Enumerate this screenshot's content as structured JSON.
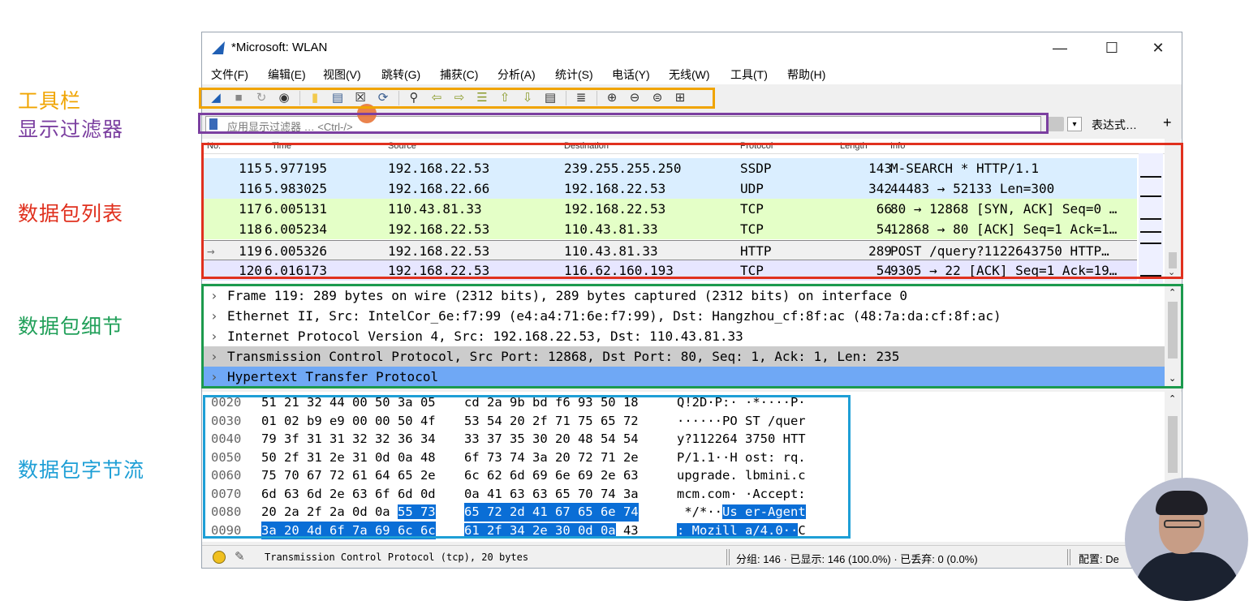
{
  "annotations": {
    "toolbar": "工具栏",
    "display_filter": "显示过滤器",
    "packet_list": "数据包列表",
    "packet_details": "数据包细节",
    "packet_bytes": "数据包字节流",
    "colors": {
      "toolbar": "#f0a400",
      "display_filter": "#7b3fa0",
      "packet_list": "#e0301e",
      "packet_details": "#1c9a4d",
      "packet_bytes": "#1e9fd6"
    }
  },
  "window": {
    "title": "*Microsoft: WLAN",
    "minimize": "—",
    "maximize": "☐",
    "close": "✕"
  },
  "menu": [
    "文件(F)",
    "编辑(E)",
    "视图(V)",
    "跳转(G)",
    "捕获(C)",
    "分析(A)",
    "统计(S)",
    "电话(Y)",
    "无线(W)",
    "工具(T)",
    "帮助(H)"
  ],
  "toolbar_icons": [
    "shark-fin-start",
    "stop",
    "restart",
    "options",
    "open",
    "save",
    "close-file",
    "reload",
    "find",
    "back",
    "forward",
    "go-to",
    "first",
    "last",
    "autoscroll",
    "colorize",
    "zoom-in",
    "zoom-out",
    "zoom-reset",
    "resize-columns"
  ],
  "filter": {
    "placeholder": "应用显示过滤器 … <Ctrl-/>",
    "dropdown": "▾",
    "expression": "表达式…",
    "add": "+"
  },
  "packet_list": {
    "headers": {
      "no": "No.",
      "time": "Time",
      "source": "Source",
      "destination": "Destination",
      "protocol": "Protocol",
      "length": "Length",
      "info": "Info"
    },
    "rows": [
      {
        "no": "115",
        "time": "5.977195",
        "src": "192.168.22.53",
        "dst": "239.255.255.250",
        "proto": "SSDP",
        "len": "143",
        "info": "M-SEARCH * HTTP/1.1",
        "bg": "#daeeff"
      },
      {
        "no": "116",
        "time": "5.983025",
        "src": "192.168.22.66",
        "dst": "192.168.22.53",
        "proto": "UDP",
        "len": "342",
        "info": "44483 → 52133 Len=300",
        "bg": "#daeeff"
      },
      {
        "no": "117",
        "time": "6.005131",
        "src": "110.43.81.33",
        "dst": "192.168.22.53",
        "proto": "TCP",
        "len": "66",
        "info": "80 → 12868 [SYN, ACK] Seq=0 …",
        "bg": "#e4ffc7"
      },
      {
        "no": "118",
        "time": "6.005234",
        "src": "192.168.22.53",
        "dst": "110.43.81.33",
        "proto": "TCP",
        "len": "54",
        "info": "12868 → 80 [ACK] Seq=1 Ack=1…",
        "bg": "#e4ffc7"
      },
      {
        "no": "119",
        "time": "6.005326",
        "src": "192.168.22.53",
        "dst": "110.43.81.33",
        "proto": "HTTP",
        "len": "289",
        "info": "POST /query?1122643750 HTTP…",
        "bg": "#f0f0f0"
      },
      {
        "no": "120",
        "time": "6.016173",
        "src": "192.168.22.53",
        "dst": "116.62.160.193",
        "proto": "TCP",
        "len": "54",
        "info": "9305 → 22 [ACK] Seq=1 Ack=19…",
        "bg": "#e7e6ff"
      }
    ]
  },
  "details": [
    {
      "text": "Frame 119: 289 bytes on wire (2312 bits), 289 bytes captured (2312 bits) on interface 0",
      "bg": "#ffffff",
      "color": "#000000"
    },
    {
      "text": "Ethernet II, Src: IntelCor_6e:f7:99 (e4:a4:71:6e:f7:99), Dst: Hangzhou_cf:8f:ac (48:7a:da:cf:8f:ac)",
      "bg": "#ffffff",
      "color": "#000000"
    },
    {
      "text": "Internet Protocol Version 4, Src: 192.168.22.53, Dst: 110.43.81.33",
      "bg": "#ffffff",
      "color": "#000000"
    },
    {
      "text": "Transmission Control Protocol, Src Port: 12868, Dst Port: 80, Seq: 1, Ack: 1, Len: 235",
      "bg": "#cccccc",
      "color": "#000000"
    },
    {
      "text": "Hypertext Transfer Protocol",
      "bg": "#6fa8f5",
      "color": "#000000"
    }
  ],
  "bytes": [
    {
      "off": "0020",
      "h1": "51 21 32 44 00 50 3a 05",
      "h2": "cd 2a 9b bd f6 93 50 18",
      "a": "Q!2D·P:· ·*····P·"
    },
    {
      "off": "0030",
      "h1": "01 02 b9 e9 00 00 50 4f",
      "h2": "53 54 20 2f 71 75 65 72",
      "a": "······PO ST /quer"
    },
    {
      "off": "0040",
      "h1": "79 3f 31 31 32 32 36 34",
      "h2": "33 37 35 30 20 48 54 54",
      "a": "y?112264 3750 HTT"
    },
    {
      "off": "0050",
      "h1": "50 2f 31 2e 31 0d 0a 48",
      "h2": "6f 73 74 3a 20 72 71 2e",
      "a": "P/1.1··H ost: rq."
    },
    {
      "off": "0060",
      "h1": "75 70 67 72 61 64 65 2e",
      "h2": "6c 62 6d 69 6e 69 2e 63",
      "a": "upgrade. lbmini.c"
    },
    {
      "off": "0070",
      "h1": "6d 63 6d 2e 63 6f 6d 0d",
      "h2": "0a 41 63 63 65 70 74 3a",
      "a": "mcm.com· ·Accept:"
    },
    {
      "off": "0080",
      "h1a": "20 2a 2f 2a 0d 0a ",
      "h1b": "55 73",
      "h2": "65 72 2d 41 67 65 6e 74",
      "aa": " */*··",
      "ab": "Us er-Agent"
    },
    {
      "off": "0090",
      "h1": "3a 20 4d 6f 7a 69 6c 6c",
      "h2a": "61 2f 34 2e 30 0d 0a",
      "h2b": " 43",
      "aa": ": Mozill a/4.0··",
      "ab": "C"
    }
  ],
  "status": {
    "text": "Transmission Control Protocol (tcp), 20 bytes",
    "stats": "分组: 146 · 已显示: 146 (100.0%) · 已丢弃: 0 (0.0%)",
    "profile": "配置: De"
  }
}
